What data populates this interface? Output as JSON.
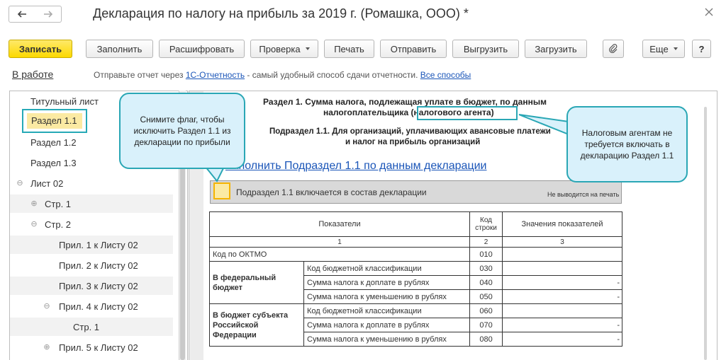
{
  "window": {
    "title": "Декларация по налогу на прибыль за 2019 г. (Ромашка, ООО) *"
  },
  "toolbar": {
    "save": "Записать",
    "fill": "Заполнить",
    "decode": "Расшифровать",
    "check": "Проверка",
    "print": "Печать",
    "send": "Отправить",
    "export": "Выгрузить",
    "import": "Загрузить",
    "more": "Еще",
    "help": "?"
  },
  "status": {
    "state": "В работе",
    "message_prefix": "Отправьте отчет через ",
    "message_link": "1С-Отчетность",
    "message_suffix": " - самый удобный способ сдачи отчетности. ",
    "all_methods_link": "Все способы"
  },
  "tree": {
    "items": [
      {
        "label": "Титульный лист"
      },
      {
        "label": "Раздел 1.1"
      },
      {
        "label": "Раздел 1.2"
      },
      {
        "label": "Раздел 1.3"
      },
      {
        "label": "Лист 02",
        "toggle": "⊖"
      },
      {
        "label": "Стр. 1",
        "toggle": "⊕"
      },
      {
        "label": "Стр. 2",
        "toggle": "⊖"
      },
      {
        "label": "Прил. 1 к Листу 02"
      },
      {
        "label": "Прил. 2 к Листу 02"
      },
      {
        "label": "Прил. 3 к Листу 02"
      },
      {
        "label": "Прил. 4 к Листу 02",
        "toggle": "⊖"
      },
      {
        "label": "Стр. 1"
      },
      {
        "label": "Прил. 5 к Листу 02",
        "toggle": "⊕"
      }
    ]
  },
  "content": {
    "section_title_line1": "Раздел 1. Сумма налога, подлежащая уплате в бюджет, по данным",
    "section_title_line2": "налогоплательщика (налогового агента)",
    "subsection_line1": "Подраздел 1.1. Для организаций, уплачивающих авансовые платежи",
    "subsection_line2": "и налог на прибыль организаций",
    "fill_link": "Заполнить Подраздел 1.1 по данным декларации",
    "include_label": "Подраздел 1.1 включается в состав декларации",
    "include_checked": false,
    "include_note": "Не выводится на печать"
  },
  "table": {
    "headers": {
      "indicators": "Показатели",
      "code": "Код строки",
      "values": "Значения показателей"
    },
    "column_numbers": [
      "1",
      "2",
      "3"
    ],
    "oktmo": {
      "label": "Код по ОКТМО",
      "code": "010",
      "value": ""
    },
    "federal": {
      "group": "В федеральный бюджет",
      "rows": [
        {
          "label": "Код бюджетной классификации",
          "code": "030",
          "value": ""
        },
        {
          "label": "Сумма налога к доплате в рублях",
          "code": "040",
          "value": "-"
        },
        {
          "label": "Сумма налога к уменьшению в рублях",
          "code": "050",
          "value": "-"
        }
      ]
    },
    "regional": {
      "group": "В бюджет субъекта Российской Федерации",
      "rows": [
        {
          "label": "Код бюджетной классификации",
          "code": "060",
          "value": ""
        },
        {
          "label": "Сумма налога к доплате в рублях",
          "code": "070",
          "value": "-"
        },
        {
          "label": "Сумма налога к уменьшению в рублях",
          "code": "080",
          "value": "-"
        }
      ]
    }
  },
  "callouts": {
    "uncheck_hint": "Снимите флаг, чтобы исключить Раздел 1.1 из декларации по прибыли",
    "agents_hint": "Налоговым агентам не требуется включать в декларацию Раздел 1.1"
  },
  "colors": {
    "accent_primary": "#fcd900",
    "callout_fill": "#d9f1fb",
    "callout_border": "#2aa7b5",
    "link": "#1a55b8",
    "selected_bg": "#fbeaa3"
  }
}
